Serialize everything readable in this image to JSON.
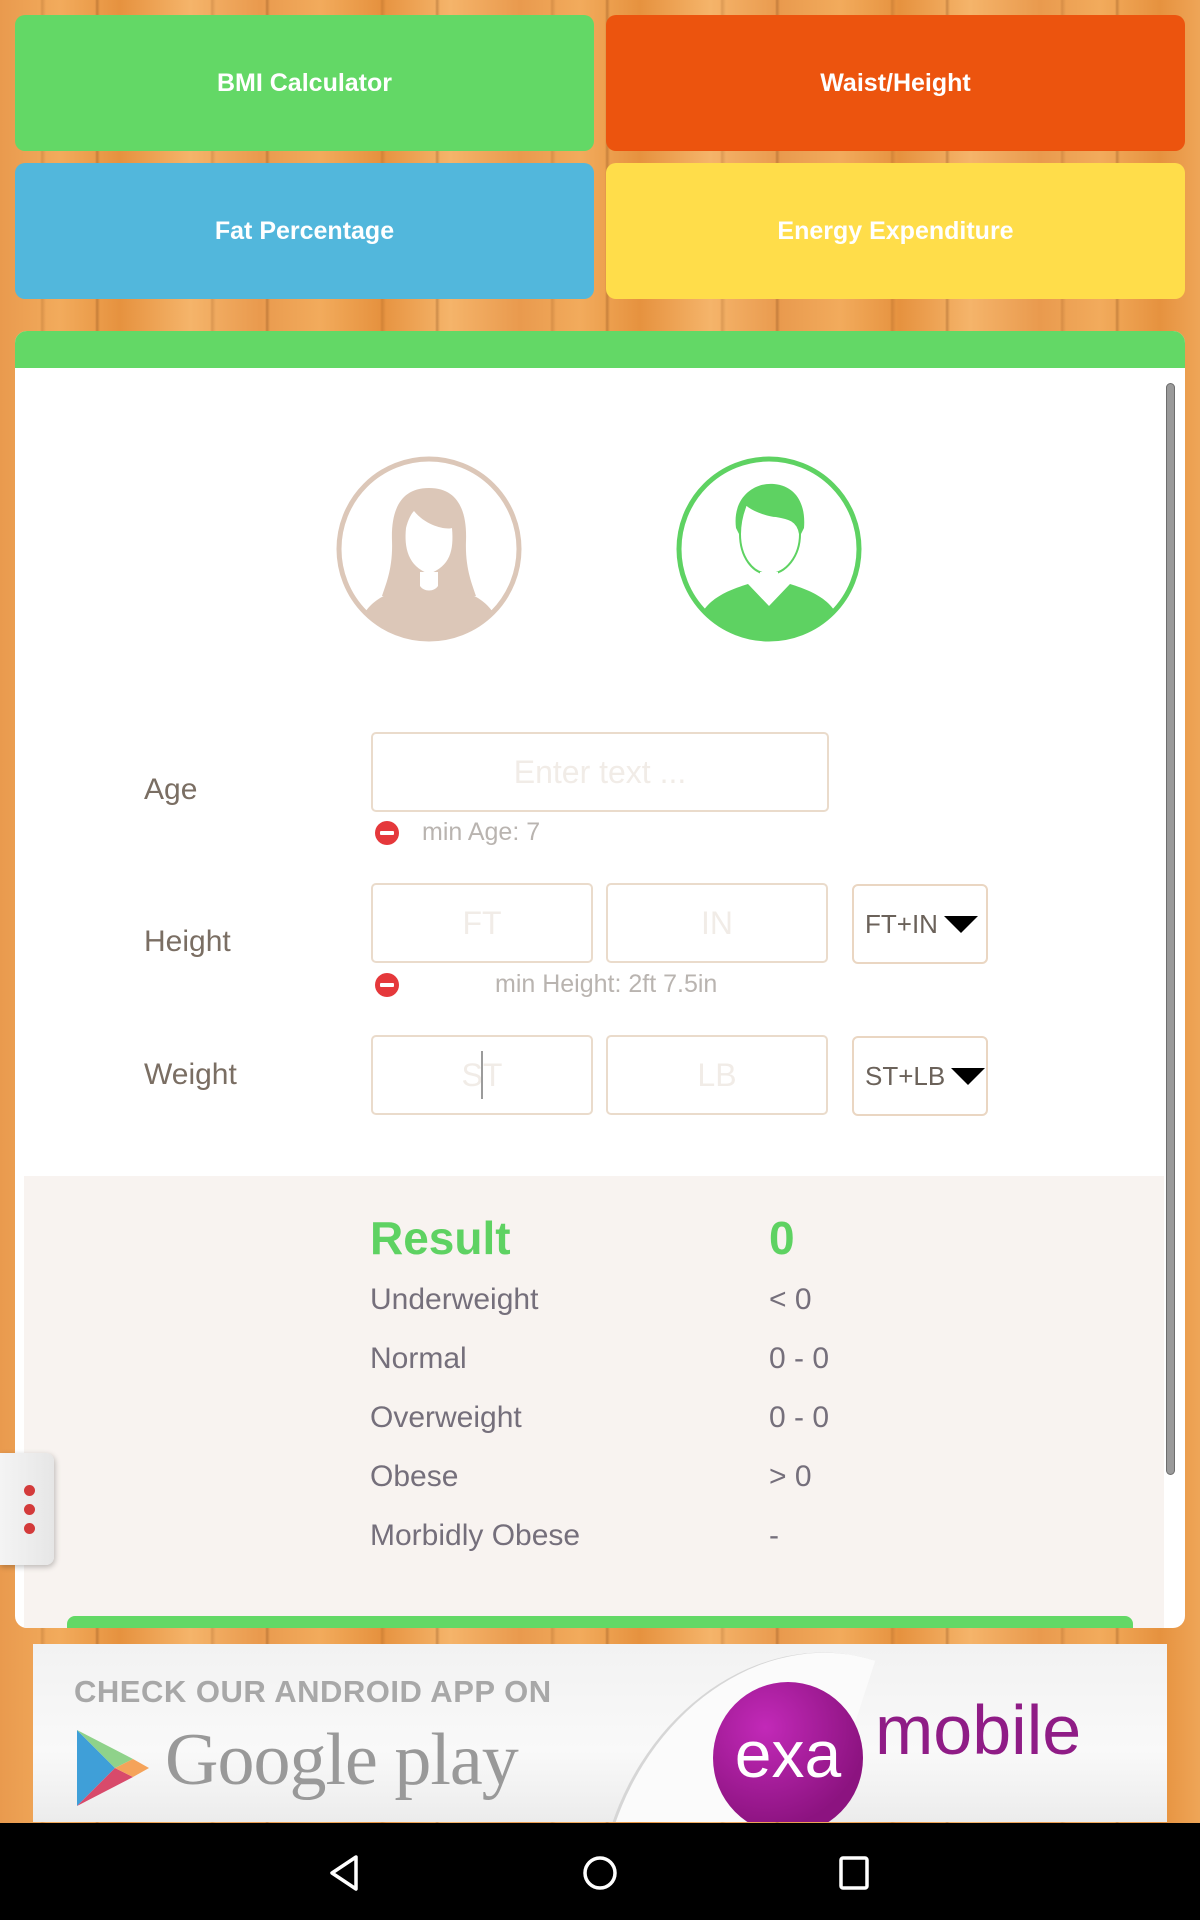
{
  "nav_buttons": [
    {
      "label": "BMI Calculator",
      "color": "#63d866"
    },
    {
      "label": "Waist/Height",
      "color": "#ec540e"
    },
    {
      "label": "Fat Percentage",
      "color": "#52b7dc"
    },
    {
      "label": "Energy Expenditure",
      "color": "#ffdd4a"
    }
  ],
  "gender": {
    "options": [
      "female",
      "male"
    ],
    "selected": "male",
    "selected_color": "#5ed262",
    "unselected_color": "#dcc7b8"
  },
  "form": {
    "age": {
      "label": "Age",
      "placeholder": "Enter text ...",
      "value": "",
      "error": "min Age: 7"
    },
    "height": {
      "label": "Height",
      "ft_placeholder": "FT",
      "in_placeholder": "IN",
      "unit": "FT+IN",
      "error": "min Height: 2ft 7.5in"
    },
    "weight": {
      "label": "Weight",
      "st_placeholder": "ST",
      "lb_placeholder": "LB",
      "unit": "ST+LB"
    }
  },
  "results": {
    "title": "Result",
    "value": "0",
    "rows": [
      {
        "label": "Underweight",
        "value": "< 0"
      },
      {
        "label": "Normal",
        "value": "0 - 0"
      },
      {
        "label": "Overweight",
        "value": "0 - 0"
      },
      {
        "label": "Obese",
        "value": "> 0"
      },
      {
        "label": "Morbidly Obese",
        "value": "-"
      }
    ]
  },
  "ad": {
    "headline": "CHECK OUR ANDROID APP ON",
    "store": "Google play",
    "brand_circle": "exa",
    "brand_rest": "mobile"
  },
  "android_nav": [
    "back",
    "home",
    "recents"
  ]
}
